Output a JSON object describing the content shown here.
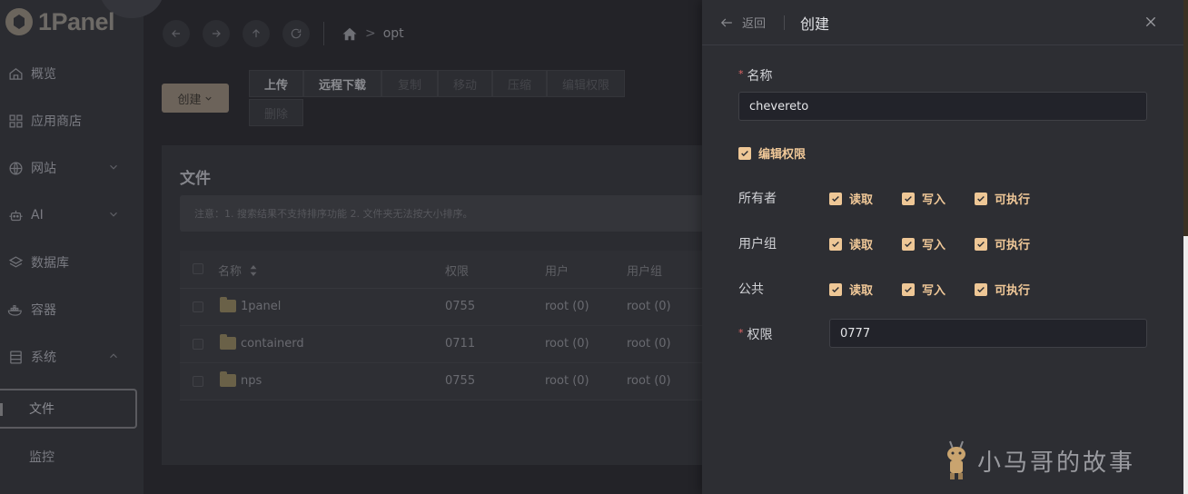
{
  "app": {
    "logo_text": "1Panel"
  },
  "sidebar": {
    "items": [
      {
        "label": "概览",
        "icon": "home-icon"
      },
      {
        "label": "应用商店",
        "icon": "grid-icon"
      },
      {
        "label": "网站",
        "icon": "globe-icon"
      },
      {
        "label": "AI",
        "icon": "robot-icon"
      },
      {
        "label": "数据库",
        "icon": "layers-icon"
      },
      {
        "label": "容器",
        "icon": "docker-icon"
      },
      {
        "label": "系统",
        "icon": "server-icon"
      }
    ],
    "sub_items": [
      {
        "label": "文件",
        "active": true
      },
      {
        "label": "监控",
        "active": false
      }
    ]
  },
  "breadcrumb": {
    "current": "opt",
    "separator": ">"
  },
  "toolbar": {
    "create_label": "创建",
    "actions": [
      "上传",
      "远程下载",
      "复制",
      "移动",
      "压缩",
      "编辑权限",
      "删除"
    ]
  },
  "files": {
    "title": "文件",
    "notice": "注意：1. 搜索结果不支持排序功能 2. 文件夹无法按大小排序。",
    "columns": [
      "名称",
      "权限",
      "用户",
      "用户组"
    ],
    "rows": [
      {
        "name": "1panel",
        "perm": "0755",
        "user": "root (0)",
        "group": "root (0)"
      },
      {
        "name": "containerd",
        "perm": "0711",
        "user": "root (0)",
        "group": "root (0)"
      },
      {
        "name": "nps",
        "perm": "0755",
        "user": "root (0)",
        "group": "root (0)"
      }
    ]
  },
  "drawer": {
    "back_label": "返回",
    "title": "创建",
    "name_label": "名称",
    "name_value": "chevereto",
    "edit_perm_label": "编辑权限",
    "groups": [
      {
        "label": "所有者",
        "read": "读取",
        "write": "写入",
        "exec": "可执行"
      },
      {
        "label": "用户组",
        "read": "读取",
        "write": "写入",
        "exec": "可执行"
      },
      {
        "label": "公共",
        "read": "读取",
        "write": "写入",
        "exec": "可执行"
      }
    ],
    "perm_label": "权限",
    "perm_value": "0777"
  },
  "watermark": {
    "text": "小马哥的故事"
  },
  "colors": {
    "accent": "#eec796",
    "required": "#e06666",
    "drawer_bg": "#2d2e33"
  }
}
